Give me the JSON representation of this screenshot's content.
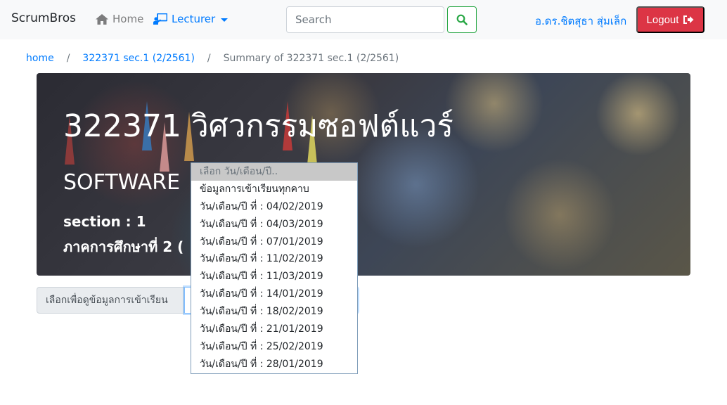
{
  "navbar": {
    "brand": "ScrumBros",
    "home_label": "Home",
    "lecturer_label": "Lecturer",
    "search_placeholder": "Search",
    "user_name": "อ.ดร.ชิตสุธา สุ่มเล็ก",
    "logout_label": "Logout",
    "icons": {
      "home": "home-icon",
      "lecturer": "chalkboard-teacher-icon",
      "search": "search-icon",
      "logout": "sign-out-icon"
    },
    "colors": {
      "link": "#007bff",
      "search_border": "#28a745",
      "logout_bg": "#dc3545"
    }
  },
  "breadcrumb": {
    "home": "home",
    "course": "322371 sec.1 (2/2561)",
    "current": "Summary of 322371 sec.1 (2/2561)",
    "separator": "/"
  },
  "jumbotron": {
    "title": "322371 วิศวกรรมซอฟต์แวร์",
    "subtitle": "SOFTWARE",
    "section": "section : 1",
    "term": "ภาคการศึกษาที่ 2 ("
  },
  "attendance": {
    "label": "เลือกเพื่อดูข้อมูลการเข้าเรียน",
    "options": [
      "เลือก วัน/เดือน/ปี..",
      "ข้อมูลการเข้าเรียนทุกคาบ",
      "วัน/เดือน/ปี ที่ : 04/02/2019",
      "วัน/เดือน/ปี ที่ : 04/03/2019",
      "วัน/เดือน/ปี ที่ : 07/01/2019",
      "วัน/เดือน/ปี ที่ : 11/02/2019",
      "วัน/เดือน/ปี ที่ : 11/03/2019",
      "วัน/เดือน/ปี ที่ : 14/01/2019",
      "วัน/เดือน/ปี ที่ : 18/02/2019",
      "วัน/เดือน/ปี ที่ : 21/01/2019",
      "วัน/เดือน/ปี ที่ : 25/02/2019",
      "วัน/เดือน/ปี ที่ : 28/01/2019"
    ]
  }
}
